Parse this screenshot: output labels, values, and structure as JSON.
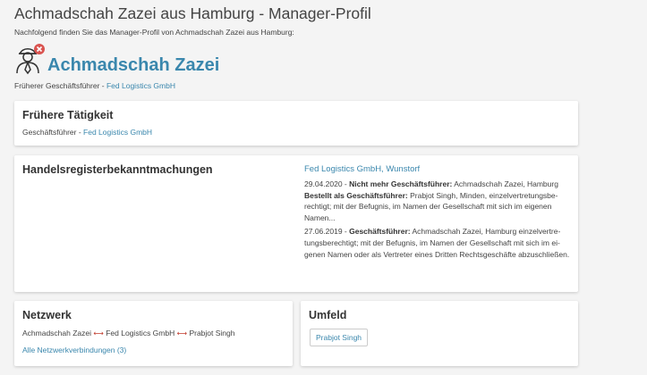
{
  "page": {
    "title": "Achmadschah Zazei aus Hamburg - Manager-Profil",
    "subtitle": "Nachfolgend finden Sie das Manager-Profil von Achmadschah Zazei aus Hamburg:"
  },
  "profile": {
    "name": "Achmadschah Zazei",
    "role_prefix": "Früherer Geschäftsführer - ",
    "company": "Fed Logistics GmbH",
    "icon": "manager-person-icon",
    "status_icon": "inactive-x-icon",
    "status_color": "#d9534f"
  },
  "former_activity": {
    "title": "Frühere Tätigkeit",
    "role_prefix": "Geschäftsführer - ",
    "company": "Fed Logistics GmbH"
  },
  "register": {
    "title": "Handelsregisterbekanntmachungen",
    "company": "Fed Logistics GmbH, Wunstorf",
    "entries": [
      {
        "date": "29.04.2020 - ",
        "label1": "Nicht mehr Geschäftsführer:",
        "text1": " Achmadschah Zazei, Hamburg",
        "label2": "Bestellt als Geschäftsführer:",
        "text2": " Prabjot Singh, Minden, einzelvertretungsbe­rechtigt; mit der Befugnis, im Namen der Gesellschaft mit sich im eigenen Namen..."
      },
      {
        "date": "27.06.2019 - ",
        "label1": "Geschäftsführer:",
        "text1": " Achmadschah Zazei, Hamburg einzelvertre­tungsberechtigt; mit der Befugnis, im Namen der Gesellschaft mit sich im ei­genen Namen oder als Vertreter eines Dritten Rechtsgeschäfte abzuschlie­ßen."
      }
    ]
  },
  "network": {
    "title": "Netzwerk",
    "nodes": [
      "Achmadschah Zazei",
      "Fed Logistics GmbH",
      "Prabjot Singh"
    ],
    "connector": "⟷",
    "all_link": "Alle Netzwerkverbindungen (3)"
  },
  "umfeld": {
    "title": "Umfeld",
    "chip": "Prabjot Singh"
  },
  "colors": {
    "link": "#3a87ad",
    "arrow": "#c0392b",
    "background": "#f4f4f4"
  }
}
